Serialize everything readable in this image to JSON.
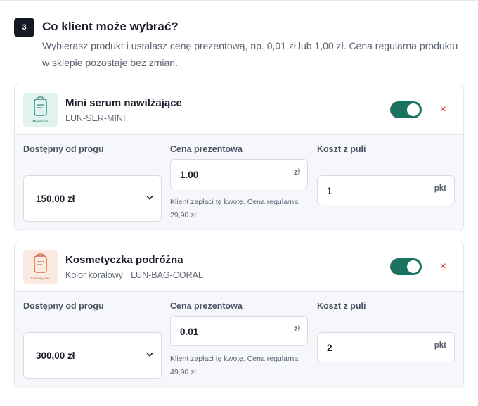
{
  "step": {
    "number": "3",
    "title": "Co klient może wybrać?",
    "description": "Wybierasz produkt i ustalasz cenę prezentową, np. 0,01 zł lub 1,00 zł. Cena regularna produktu w sklepie pozostaje bez zmian."
  },
  "columns": {
    "threshold_label": "Dostępny od progu",
    "price_label": "Cena prezentowa",
    "cost_label": "Koszt z puli"
  },
  "products": [
    {
      "name": "Mini serum nawilżające",
      "subtitle": "LUN-SER-MINI",
      "thumb_label": "Mini serum",
      "thumb_bg": "#e0f3ee",
      "thumb_color": "#1c7260",
      "enabled": true,
      "remove_label": "×",
      "threshold_value": "150,00 zł",
      "price_value": "1.00",
      "price_unit": "zł",
      "price_hint": "Klient zapłaci tę kwotę. Cena regularna: 29,90 zł.",
      "points_value": "1",
      "points_unit": "pkt"
    },
    {
      "name": "Kosmetyczka podróżna",
      "subtitle": "Kolor koralowy · LUN-BAG-CORAL",
      "thumb_label": "Kosmetyczka",
      "thumb_bg": "#fbeae1",
      "thumb_color": "#c2562c",
      "enabled": true,
      "remove_label": "×",
      "threshold_value": "300,00 zł",
      "price_value": "0.01",
      "price_unit": "zł",
      "price_hint": "Klient zapłaci tę kwotę. Cena regularna: 49,90 zł.",
      "points_value": "2",
      "points_unit": "pkt"
    }
  ],
  "colors": {
    "accent": "#1c7260",
    "danger": "#d23b3b",
    "badge": "#141923"
  }
}
